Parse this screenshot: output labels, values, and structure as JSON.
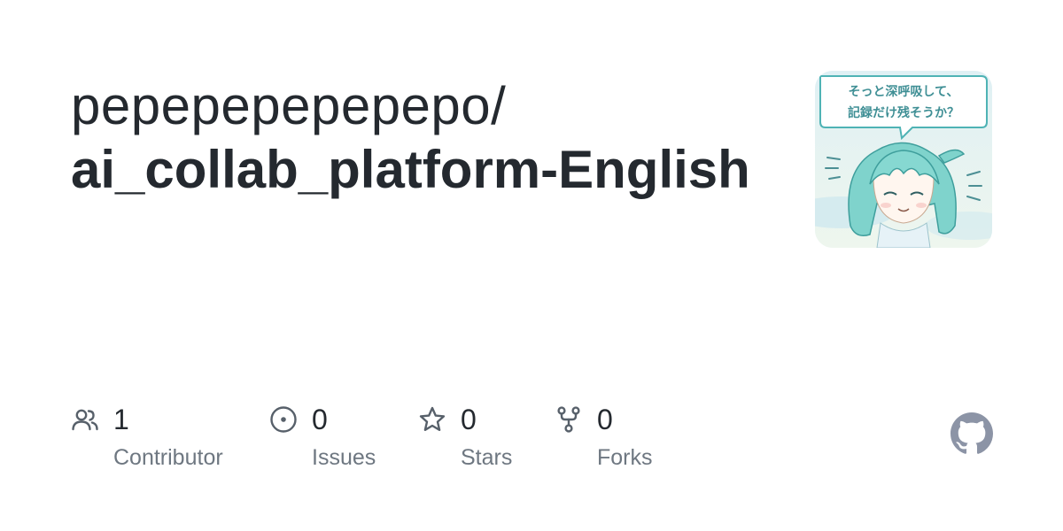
{
  "repo": {
    "owner": "pepepepepepepo/",
    "name": "ai_collab_platform-English"
  },
  "avatar": {
    "speech_line_1": "そっと深呼吸して、",
    "speech_line_2": "記録だけ残そうか？"
  },
  "stats": [
    {
      "icon": "people-icon",
      "value": "1",
      "label": "Contributor"
    },
    {
      "icon": "issue-icon",
      "value": "0",
      "label": "Issues"
    },
    {
      "icon": "star-icon",
      "value": "0",
      "label": "Stars"
    },
    {
      "icon": "fork-icon",
      "value": "0",
      "label": "Forks"
    }
  ],
  "colors": {
    "text": "#24292f",
    "muted": "#6e7781",
    "icon": "#57606a",
    "github_mark": "#8c94a6",
    "avatar_accent": "#5fc4c0"
  }
}
